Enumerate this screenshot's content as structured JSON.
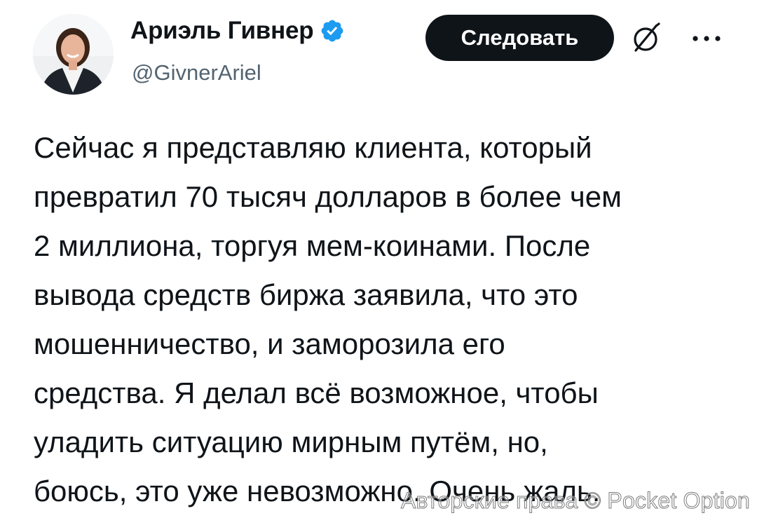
{
  "author": {
    "display_name": "Ариэль Гивнер",
    "handle": "@GivnerAriel",
    "verified": true
  },
  "actions": {
    "follow_label": "Следовать",
    "grok_icon": "grok-icon",
    "more_icon": "more-horizontal-icon"
  },
  "tweet": {
    "lines": [
      "Сейчас я представляю клиента, который",
      "превратил 70 тысяч долларов в более чем",
      "2 миллиона, торгуя мем-коинами. После",
      "вывода средств биржа заявила, что это",
      "мошенничество, и заморозила его",
      "средства. Я делал всё возможное, чтобы",
      "уладить ситуацию мирным путём, но,",
      "боюсь, это уже невозможно. Очень жаль."
    ]
  },
  "watermark": "Авторские права © Pocket Option",
  "colors": {
    "text": "#0f1419",
    "secondary": "#536471",
    "verified": "#1d9bf0",
    "button_bg": "#0f1419",
    "button_text": "#ffffff"
  }
}
